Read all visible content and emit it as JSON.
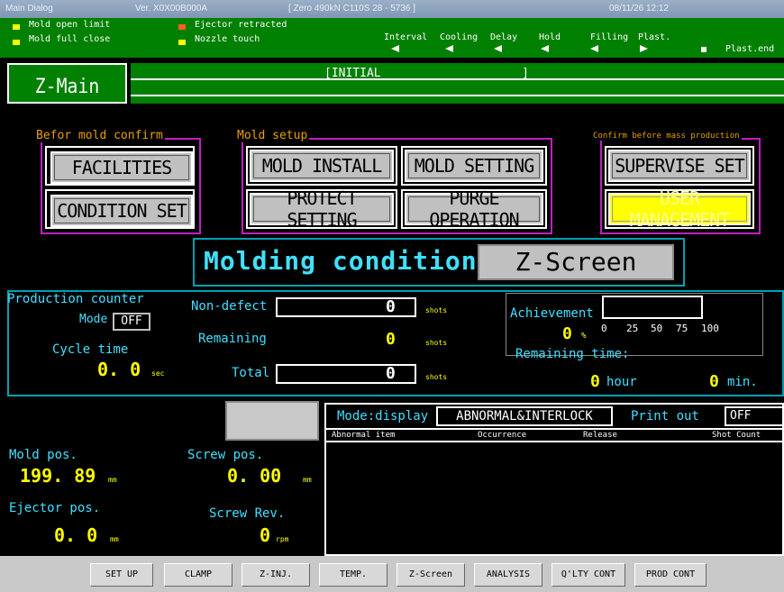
{
  "titlebar": {
    "app": "Main Dialog",
    "version": "Ver. X0X00B000A",
    "machine": "[ Zero  490kN  C110S  28 - 5736 ]",
    "datetime": "08/11/26 12:12"
  },
  "status": {
    "mold_open_limit": "Mold open limit",
    "mold_full_close": "Mold full close",
    "ejector_retracted": "Ejector retracted",
    "nozzle_touch": "Nozzle touch",
    "interval": "Interval",
    "cooling": "Cooling",
    "delay": "Delay",
    "hold": "Hold",
    "filling": "Filling",
    "plast": "Plast.",
    "plast_end": "Plast.end",
    "indicator_on_color": "#ffff00",
    "indicator_alert_color": "#ff6020"
  },
  "header": {
    "screen_title": "Z-Main",
    "state": "[INITIAL                    ]"
  },
  "sections": {
    "before_mold_confirm": "Befor mold confirm",
    "mold_setup": "Mold setup",
    "confirm_mass_production": "Confirm before mass production"
  },
  "buttons": {
    "facilities": "FACILITIES",
    "condition_set": "CONDITION SET",
    "mold_install": "MOLD INSTALL",
    "mold_setting": "MOLD SETTING",
    "protect_setting": "PROTECT SETTING",
    "purge_operation": "PURGE OPERATION",
    "supervise_set": "SUPERVISE SET",
    "user_management": "USER MANAGEMENT"
  },
  "molding": {
    "label": "Molding condition",
    "button": "Z-Screen"
  },
  "production": {
    "counter_label": "Production counter",
    "mode_label": "Mode",
    "mode_value": "OFF",
    "cycle_time_label": "Cycle time",
    "cycle_time_value": "0. 0",
    "cycle_time_unit": "sec",
    "non_defect_label": "Non-defect",
    "non_defect_value": "0",
    "remaining_label": "Remaining",
    "remaining_value": "0",
    "total_label": "Total",
    "total_value": "0",
    "shots_unit": "shots",
    "achievement_label": "Achievement",
    "achievement_value": "0",
    "achievement_unit": "%",
    "achievement_ticks": [
      "0",
      "25",
      "50",
      "75",
      "100"
    ],
    "remaining_time_label": "Remaining time:",
    "hour_value": "0",
    "hour_unit": "hour",
    "min_value": "0",
    "min_unit": "min."
  },
  "positions": {
    "mold_pos_label": "Mold pos.",
    "mold_pos_value": "199. 89",
    "screw_pos_label": "Screw pos.",
    "screw_pos_value": "0. 00",
    "ejector_pos_label": "Ejector pos.",
    "ejector_pos_value": "0. 0",
    "screw_rev_label": "Screw Rev.",
    "screw_rev_value": "0",
    "mm_unit": "mm",
    "rpm_unit": "rpm"
  },
  "alarm": {
    "mode_label": "Mode:display",
    "mode_value": "ABNORMAL&INTERLOCK",
    "print_label": "Print out",
    "print_value": "OFF",
    "columns": [
      "Abnormal item",
      "Occurrence",
      "Release",
      "Shot Count"
    ]
  },
  "nav": [
    "SET UP",
    "CLAMP",
    "Z-INJ.",
    "TEMP.",
    "Z-Screen",
    "ANALYSIS",
    "Q'LTY CONT",
    "PROD CONT"
  ]
}
